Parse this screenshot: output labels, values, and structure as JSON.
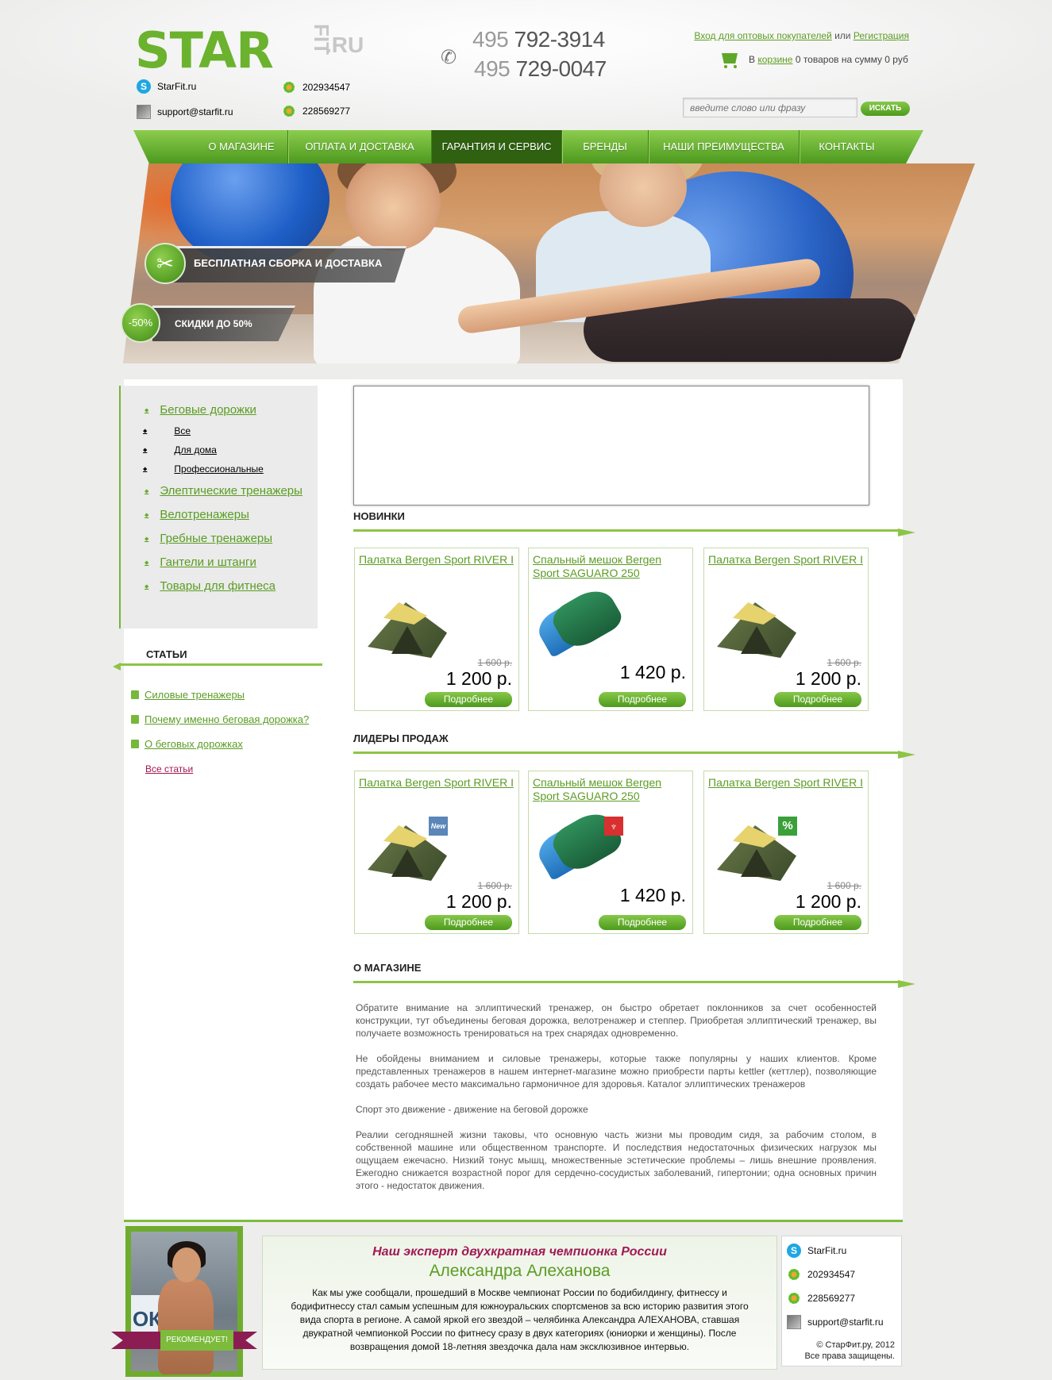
{
  "header": {
    "logo": {
      "star": "STAR",
      "fit": "FIT",
      "ru": ".RU"
    },
    "skype": "StarFit.ru",
    "email": "support@starfit.ru",
    "icq1": "202934547",
    "icq2": "228569277",
    "phone1": {
      "code": "495",
      "number": "792-3914"
    },
    "phone2": {
      "code": "495",
      "number": "729-0047"
    },
    "wholesale_link": "Вход для оптовых покупателей",
    "or_text": "или",
    "register_link": "Регистрация",
    "cart": {
      "prefix": "В",
      "link": "корзине",
      "summary": "0 товаров на сумму 0 руб"
    },
    "search": {
      "placeholder": "введите слово или фразу",
      "button": "ИСКАТЬ"
    }
  },
  "nav": [
    "О МАГАЗИНЕ",
    "ОПЛАТА И ДОСТАВКА",
    "ГАРАНТИЯ И СЕРВИС",
    "БРЕНДЫ",
    "НАШИ ПРЕИМУЩЕСТВА",
    "КОНТАКТЫ"
  ],
  "nav_active": "ГАРАНТИЯ И СЕРВИС",
  "banner": {
    "promo1": "БЕСПЛАТНАЯ СБОРКА И ДОСТАВКА",
    "promo2_badge": "-50%",
    "promo2": "СКИДКИ ДО 50%"
  },
  "sidebar": {
    "categories": [
      {
        "label": "Беговые дорожки",
        "children": [
          "Все",
          "Для дома",
          "Профессиональные"
        ]
      },
      {
        "label": "Элептические тренажеры"
      },
      {
        "label": "Велотренажеры"
      },
      {
        "label": "Гребные тренажеры"
      },
      {
        "label": "Гантели и штанги"
      },
      {
        "label": "Товары для фитнеса"
      }
    ],
    "articles_title": "СТАТЬИ",
    "articles": [
      "Силовые тренажеры",
      "Почему именно беговая дорожка?",
      "О беговых дорожках"
    ],
    "all_articles": "Все статьи"
  },
  "sections": {
    "new": "НОВИНКИ",
    "leaders": "ЛИДЕРЫ ПРОДАЖ",
    "about": "О МАГАЗИНЕ"
  },
  "new_products": [
    {
      "name": "Палатка Bergen Sport RIVER I",
      "old_price": "1 600 р.",
      "price": "1 200 р.",
      "button": "Подробнее",
      "image": "tent"
    },
    {
      "name": "Спальный мешок Bergen Sport SAGUARO 250",
      "old_price": "",
      "price": "1 420 р.",
      "button": "Подробнее",
      "image": "sleeping-bag"
    },
    {
      "name": "Палатка Bergen Sport RIVER I",
      "old_price": "1 600 р.",
      "price": "1 200 р.",
      "button": "Подробнее",
      "image": "tent"
    }
  ],
  "leader_products": [
    {
      "name": "Палатка Bergen Sport RIVER I",
      "old_price": "1 600 р.",
      "price": "1 200 р.",
      "button": "Подробнее",
      "image": "tent",
      "badge": "New",
      "badge_color": "#5b86b8"
    },
    {
      "name": "Спальный мешок Bergen Sport SAGUARO 250",
      "old_price": "",
      "price": "1 420 р.",
      "button": "Подробнее",
      "image": "sleeping-bag",
      "badge": "trophy-icon",
      "badge_color": "#d7302f"
    },
    {
      "name": "Палатка Bergen Sport RIVER I",
      "old_price": "1 600 р.",
      "price": "1 200 р.",
      "button": "Подробнее",
      "image": "tent",
      "badge": "%",
      "badge_color": "#3aa03a"
    }
  ],
  "about": [
    "Обратите внимание на эллиптический тренажер, он быстро обретает поклонников за счет особенностей конструкции, тут объединены беговая дорожка, велотренажер и степпер. Приобретая эллиптический тренажер, вы получаете возможность тренироваться на трех снарядах одновременно.",
    "Не обойдены вниманием и силовые тренажеры, которые также популярны у наших клиентов. Кроме представленных тренажеров в нашем интернет-магазине можно приобрести парты kettler (кеттлер), позволяющие создать рабочее место максимально гармоничное для здоровья. Каталог эллиптических тренажеров",
    "Спорт это движение - движение на беговой дорожке",
    "Реалии сегодняшней жизни таковы, что основную часть жизни мы проводим сидя, за рабочим столом, в собственной машине или общественном транспорте. И последствия недостаточных физических нагрузок мы ощущаем ежечасно. Низкий тонус мышц, множественные эстетические проблемы – лишь внешние проявления. Ежегодно снижается возрастной порог для сердечно-сосудистых заболеваний, гипертонии; одна основных причин этого - недостаток движения."
  ],
  "footer": {
    "photo_sign": "ОК",
    "recommends": "РЕКОМЕНДУЕТ!",
    "expert_title": "Наш эксперт двухкратная чемпионка России",
    "expert_name": "Александра Алеханова",
    "expert_text": "Как мы уже сообщали, прошедший в Москве чемпионат России по бодибилдингу, фитнессу и бодифитнессу стал самым успешным для южноуральских спортсменов за всю историю развития этого вида спорта в регионе. А самой яркой его звездой – челябинка Александра АЛЕХАНОВА, ставшая двукратной чемпионкой России по фитнесу сразу в двух категориях (юниорки и женщины). После возвращения домой 18-летняя звездочка дала нам эксклюзивное интервью.",
    "skype": "StarFit.ru",
    "icq1": "202934547",
    "icq2": "228569277",
    "email": "support@starfit.ru",
    "copyright1": "© СтарФит.ру, 2012",
    "copyright2": "Все права защищены."
  },
  "colors": {
    "accent": "#6bb22e",
    "link": "#5c9c24",
    "article_link": "#a31650",
    "nav_active": "#2f6110"
  }
}
